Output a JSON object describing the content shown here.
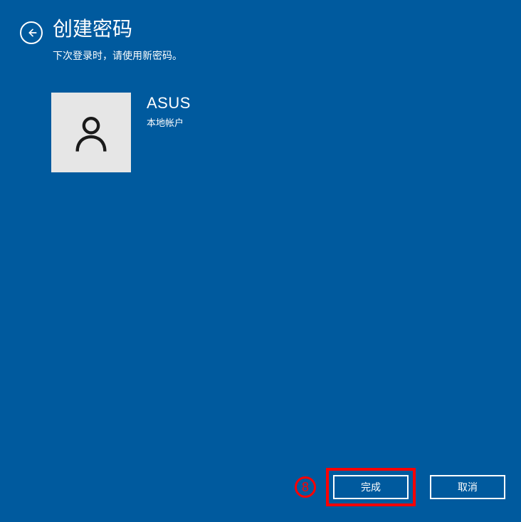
{
  "header": {
    "title": "创建密码",
    "subtitle": "下次登录时，请使用新密码。"
  },
  "user": {
    "name": "ASUS",
    "account_type": "本地帐户"
  },
  "footer": {
    "annotation_number": "8",
    "finish_label": "完成",
    "cancel_label": "取消"
  }
}
